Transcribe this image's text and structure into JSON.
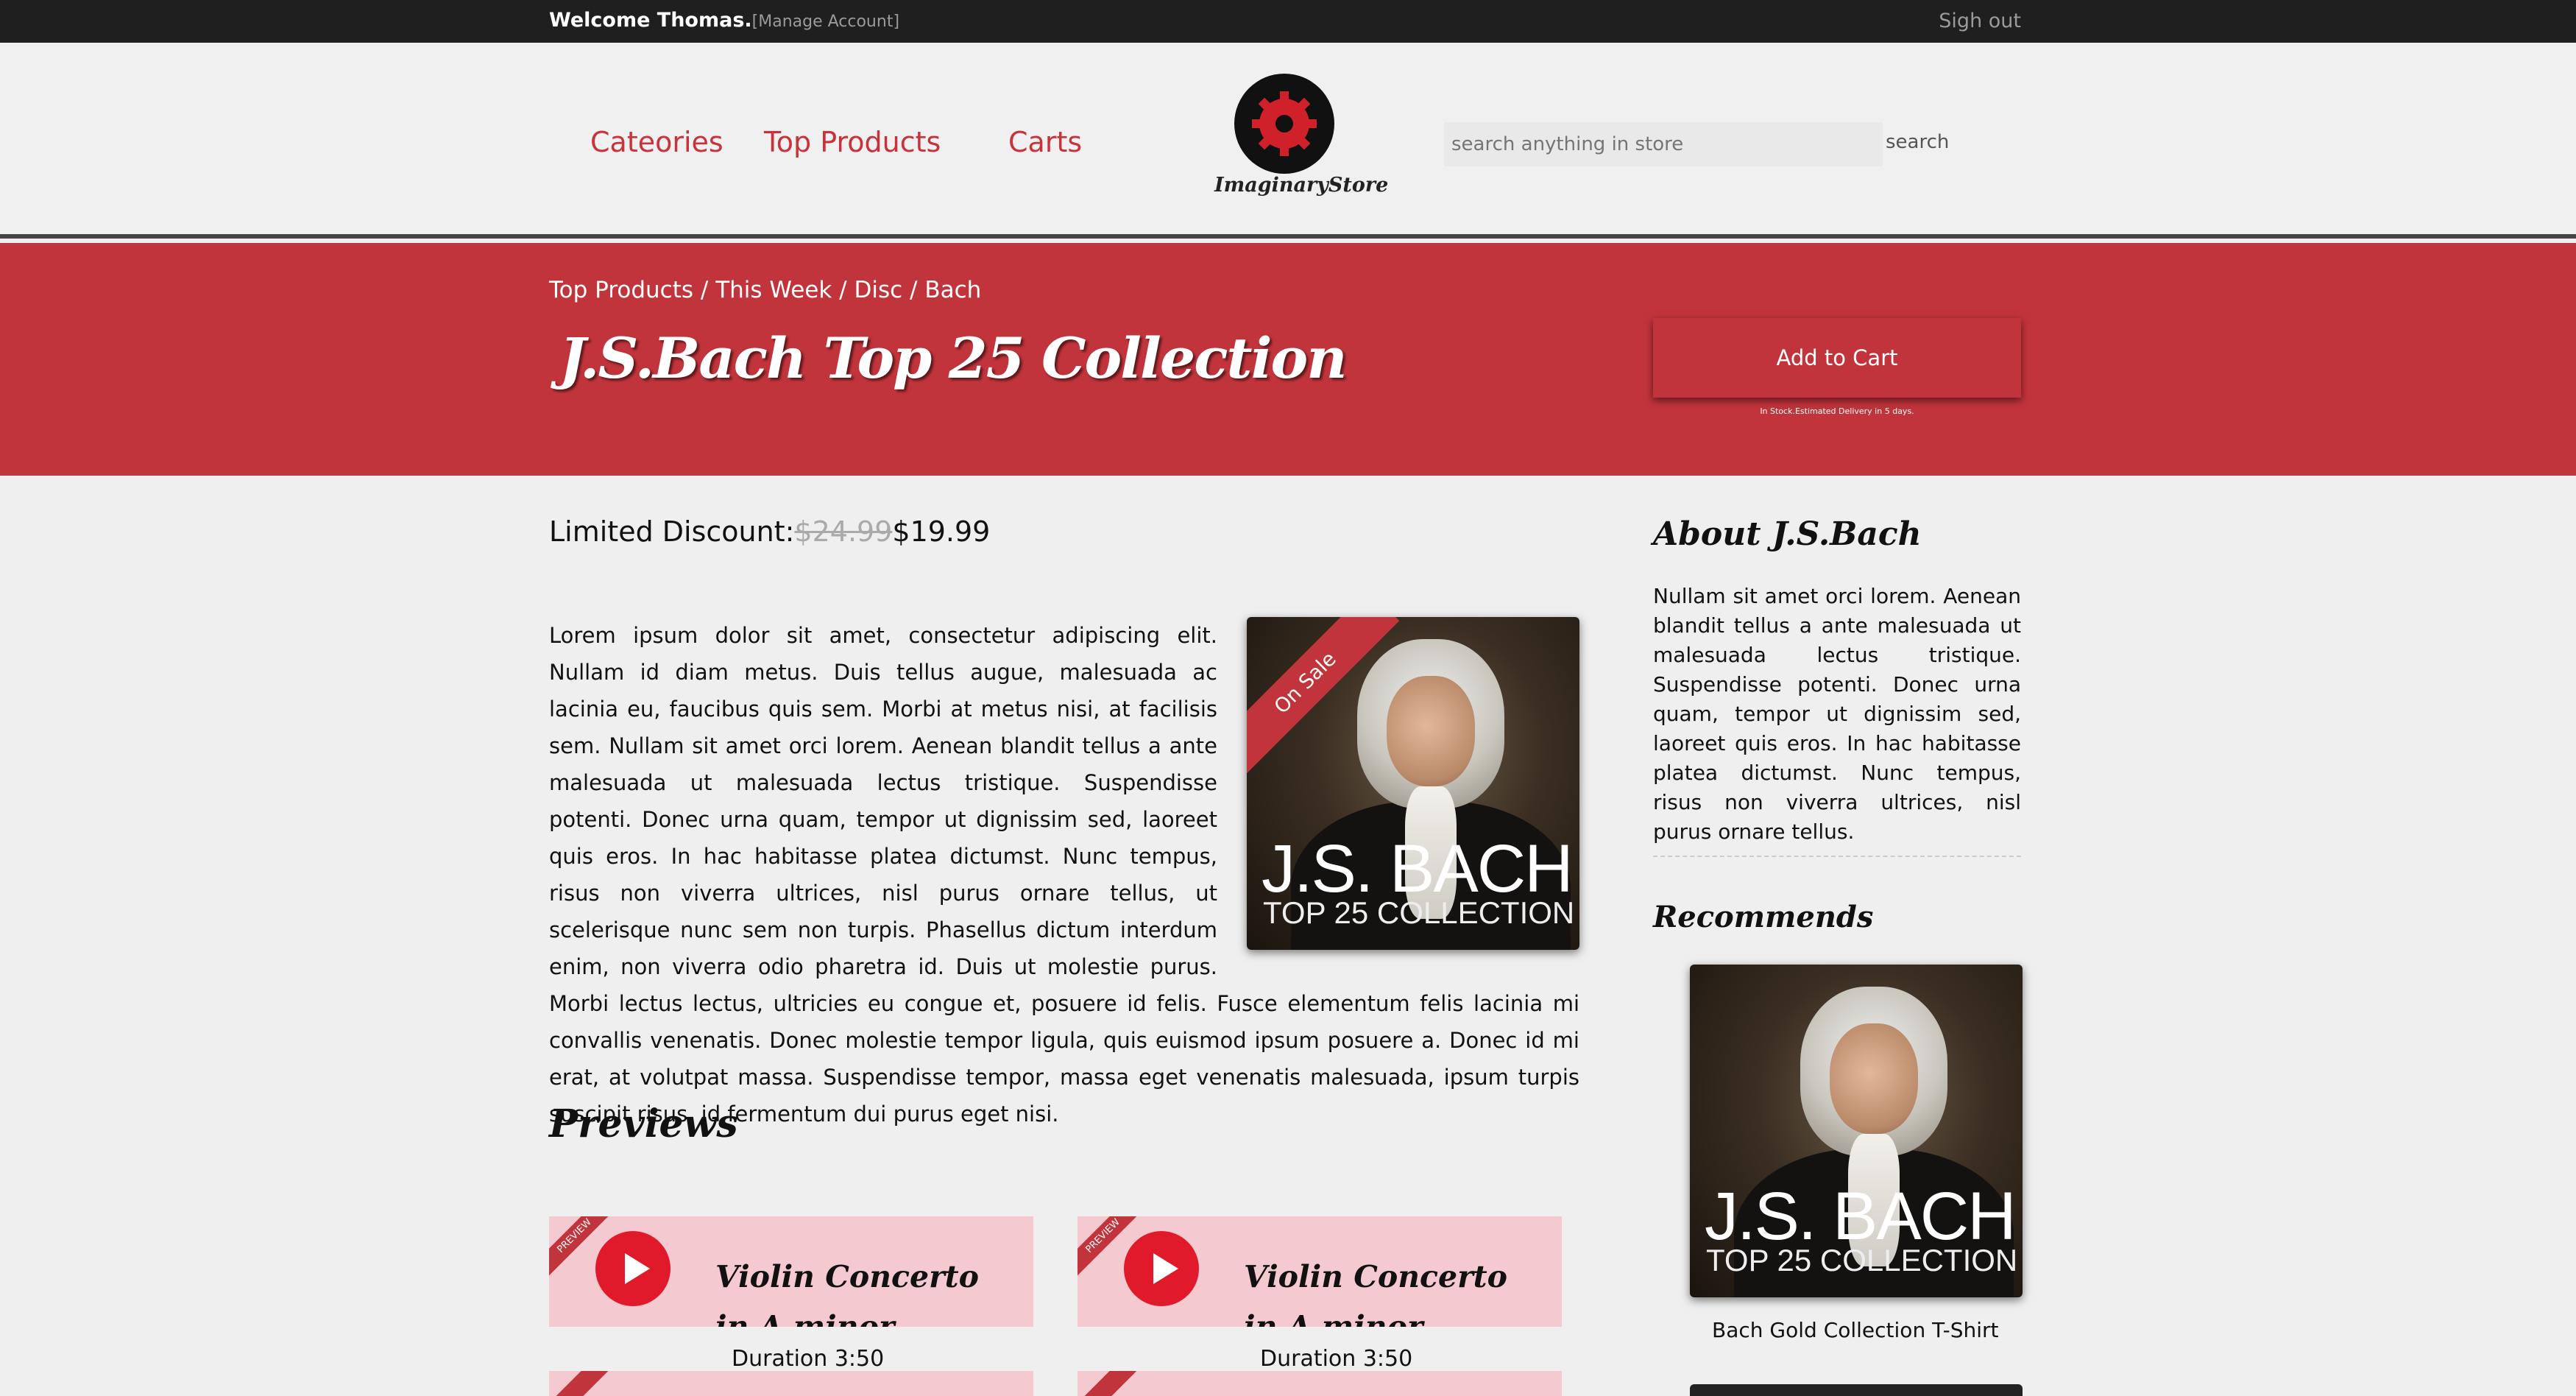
{
  "topbar": {
    "welcome": "Welcome Thomas.",
    "manage_account": "[Manage Account]",
    "sign_out": "Sigh out"
  },
  "nav": {
    "categories": "Cateories",
    "top_products": "Top Products",
    "carts": "Carts"
  },
  "logo": {
    "brand": "ImaginaryStore"
  },
  "search": {
    "placeholder": "search anything in store",
    "button_label": "search"
  },
  "breadcrumb": [
    "Top Products",
    "This Week",
    "Disc",
    "Bach"
  ],
  "product": {
    "title": "J.S.Bach Top 25 Collection",
    "add_to_cart": "Add to Cart",
    "stock_note": "In Stock.Estimated Delivery in 5 days.",
    "price_label": "Limited Discount:",
    "old_price": "$24.99",
    "new_price": "$19.99",
    "description": "Lorem ipsum dolor sit amet, consectetur adipiscing elit. Nullam id diam metus. Duis tellus augue, malesuada ac lacinia eu, faucibus quis sem. Morbi at metus nisi, at facilisis sem. Nullam sit amet orci lorem. Aenean blandit tellus a ante malesuada ut malesuada lectus tristique. Suspendisse potenti. Donec urna quam, tempor ut dignissim sed, laoreet quis eros. In hac habitasse platea dictumst. Nunc tempus, risus non viverra ultrices, nisl purus ornare tellus, ut scelerisque nunc sem non turpis. Phasellus dictum interdum enim, non viverra odio pharetra id. Duis ut molestie purus. Morbi lectus lectus, ultricies eu congue et, posuere id felis. Fusce elementum felis lacinia mi convallis venenatis. Donec molestie tempor ligula, quis euismod ipsum posuere a. Donec id mi erat, at volutpat massa. Suspendisse tempor, massa eget venenatis malesuada, ipsum turpis suscipit risus, id fermentum dui purus eget nisi.",
    "badge": "On Sale",
    "cover_title": "J.S. BACH",
    "cover_subtitle": "TOP 25 COLLECTION"
  },
  "previews": {
    "title": "Previews",
    "ribbon": "PREVIEW",
    "items": [
      {
        "track": "Violin Concerto in A minor",
        "duration": "Duration 3:50"
      },
      {
        "track": "Violin Concerto in A minor",
        "duration": "Duration 3:50"
      }
    ]
  },
  "sidebar": {
    "about_title": "About J.S.Bach",
    "about_text": "Nullam sit amet orci lorem. Aenean blandit tellus a ante malesuada ut malesuada lectus tristique. Suspendisse potenti. Donec urna quam, tempor ut dignissim sed, laoreet quis eros. In hac habitasse platea dictumst. Nunc tempus, risus non viverra ultrices, nisl purus ornare tellus.",
    "recommends_title": "Recommends",
    "recommend_item_label": "Bach Gold Collection T-Shirt"
  },
  "colors": {
    "accent": "#c2343b",
    "topbar": "#1f1f1f",
    "preview_card": "#f4c9d0",
    "play_button": "#e01a2a"
  }
}
